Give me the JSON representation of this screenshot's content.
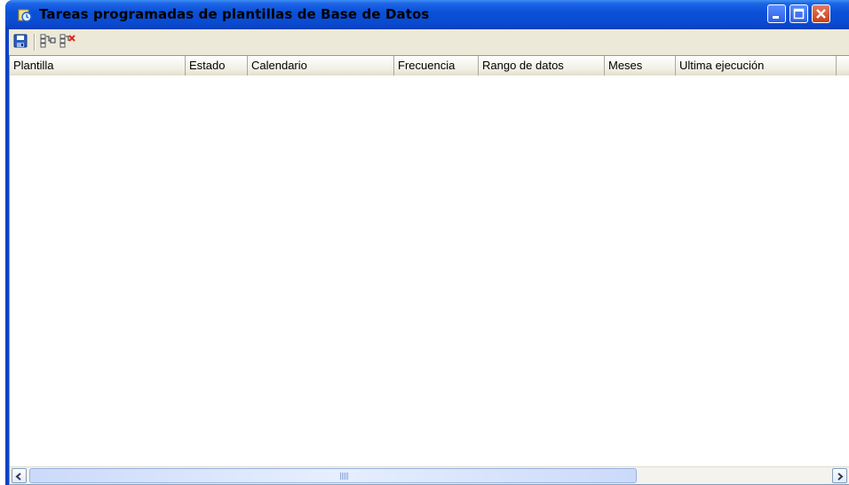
{
  "window": {
    "title": "Tareas programadas de plantillas de Base de Datos"
  },
  "toolbar": {
    "items": [
      {
        "icon": "save-icon"
      },
      {
        "icon": "add-task-icon"
      },
      {
        "icon": "remove-task-icon"
      }
    ]
  },
  "table": {
    "columns": [
      {
        "label": "Plantilla"
      },
      {
        "label": "Estado"
      },
      {
        "label": "Calendario"
      },
      {
        "label": "Frecuencia"
      },
      {
        "label": "Rango de datos"
      },
      {
        "label": "Meses"
      },
      {
        "label": "Ultima ejecución"
      },
      {
        "label": ""
      }
    ],
    "rows": []
  },
  "colors": {
    "titlebar": "#0a4ad0",
    "face": "#ece9d8",
    "close": "#c8401c"
  }
}
